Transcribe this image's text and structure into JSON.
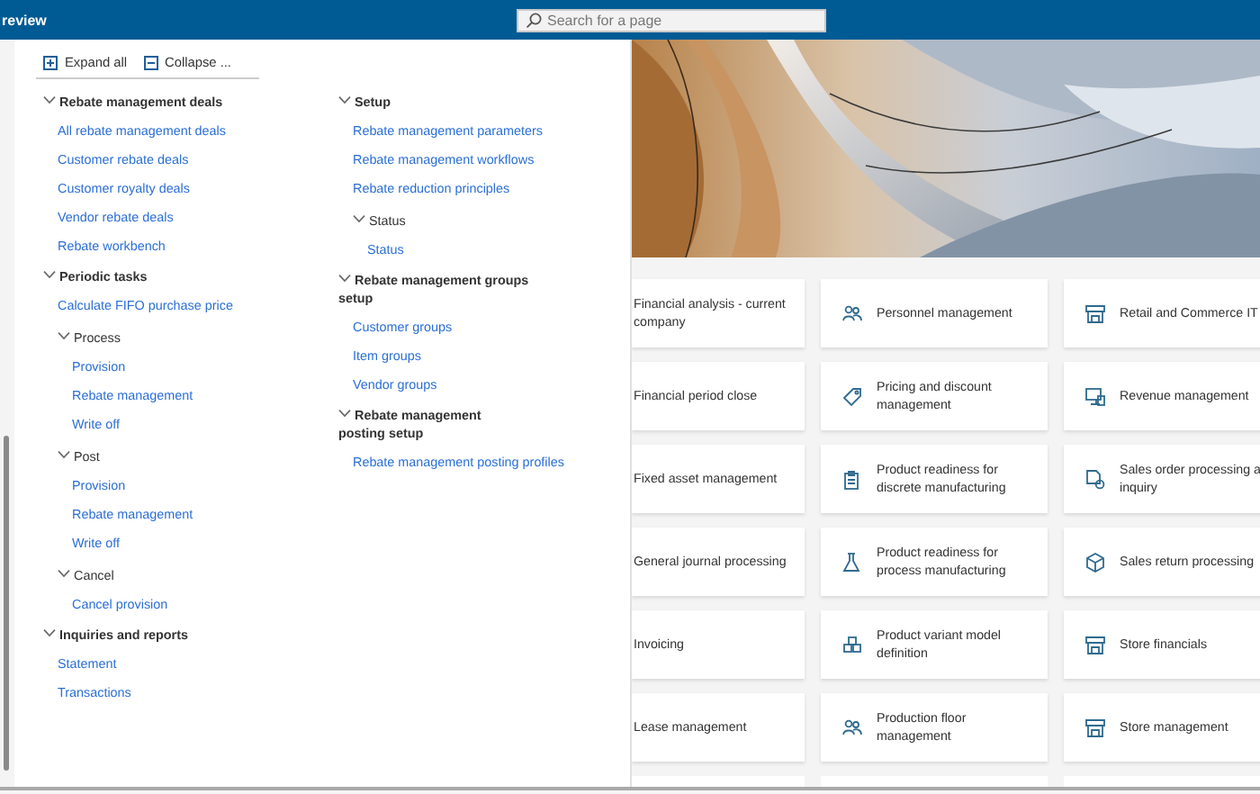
{
  "topbar": {
    "title": "review",
    "search": {
      "placeholder": "Search for a page"
    }
  },
  "toolbar": [
    {
      "label": "Expand all"
    },
    {
      "label": "Collapse ..."
    }
  ],
  "columns": [
    [
      {
        "label": "Rebate management deals",
        "expanded": true,
        "children": [
          {
            "kind": "link",
            "label": "All rebate management deals"
          },
          {
            "kind": "link",
            "label": "Customer rebate deals"
          },
          {
            "kind": "link",
            "label": "Customer royalty deals"
          },
          {
            "kind": "link",
            "label": "Vendor rebate deals"
          },
          {
            "kind": "link",
            "label": "Rebate workbench"
          }
        ]
      },
      {
        "label": "Periodic tasks",
        "expanded": true,
        "children": [
          {
            "kind": "link",
            "label": "Calculate FIFO purchase price"
          },
          {
            "kind": "group",
            "label": "Process",
            "expanded": true,
            "children": [
              {
                "label": "Provision"
              },
              {
                "label": "Rebate management"
              },
              {
                "label": "Write off"
              }
            ]
          },
          {
            "kind": "group",
            "label": "Post",
            "expanded": true,
            "children": [
              {
                "label": "Provision"
              },
              {
                "label": "Rebate management"
              },
              {
                "label": "Write off"
              }
            ]
          },
          {
            "kind": "group",
            "label": "Cancel",
            "expanded": true,
            "children": [
              {
                "label": "Cancel provision"
              }
            ]
          }
        ]
      },
      {
        "label": "Inquiries and reports",
        "expanded": true,
        "children": [
          {
            "kind": "link",
            "label": "Statement"
          },
          {
            "kind": "link",
            "label": "Transactions"
          }
        ]
      }
    ],
    [
      {
        "label": "Setup",
        "expanded": true,
        "children": [
          {
            "kind": "link",
            "label": "Rebate management parameters"
          },
          {
            "kind": "link",
            "label": "Rebate management workflows"
          },
          {
            "kind": "link",
            "label": "Rebate reduction principles"
          },
          {
            "kind": "group",
            "label": "Status",
            "expanded": true,
            "children": [
              {
                "label": "Status"
              }
            ]
          }
        ]
      },
      {
        "label": "Rebate management groups setup",
        "expanded": true,
        "children": [
          {
            "kind": "link",
            "label": "Customer groups"
          },
          {
            "kind": "link",
            "label": "Item groups"
          },
          {
            "kind": "link",
            "label": "Vendor groups"
          }
        ]
      },
      {
        "label": "Rebate management posting setup",
        "expanded": true,
        "children": [
          {
            "kind": "link",
            "label": "Rebate management posting profiles"
          }
        ]
      }
    ]
  ],
  "hero": {
    "kind": "picture"
  },
  "tiles": [
    {
      "kind": "plain",
      "lines": [
        "Financial analysis - current",
        "company"
      ]
    },
    {
      "kind": "icon",
      "lines": [
        "Personnel management"
      ]
    },
    {
      "kind": "icon",
      "lines": [
        "Retail and Commerce IT"
      ]
    },
    {
      "kind": "plain",
      "lines": [
        "Financial period close"
      ]
    },
    {
      "kind": "icon",
      "lines": [
        "Pricing and discount",
        "management"
      ]
    },
    {
      "kind": "icon",
      "lines": [
        "Revenue management"
      ]
    },
    {
      "kind": "plain",
      "lines": [
        "Fixed asset management"
      ]
    },
    {
      "kind": "icon",
      "lines": [
        "Product readiness for",
        "discrete manufacturing"
      ]
    },
    {
      "kind": "icon",
      "lines": [
        "Sales order processing a",
        "inquiry"
      ]
    },
    {
      "kind": "plain",
      "lines": [
        "General journal processing"
      ]
    },
    {
      "kind": "icon",
      "lines": [
        "Product readiness for",
        "process manufacturing"
      ]
    },
    {
      "kind": "icon",
      "lines": [
        "Sales return processing"
      ]
    },
    {
      "kind": "plain",
      "lines": [
        "Invoicing"
      ]
    },
    {
      "kind": "icon",
      "lines": [
        "Product variant model",
        "definition"
      ]
    },
    {
      "kind": "icon",
      "lines": [
        "Store financials"
      ]
    },
    {
      "kind": "plain",
      "lines": [
        "Lease management"
      ]
    },
    {
      "kind": "icon",
      "lines": [
        "Production floor",
        "management"
      ]
    },
    {
      "kind": "icon",
      "lines": [
        "Store management"
      ]
    }
  ]
}
